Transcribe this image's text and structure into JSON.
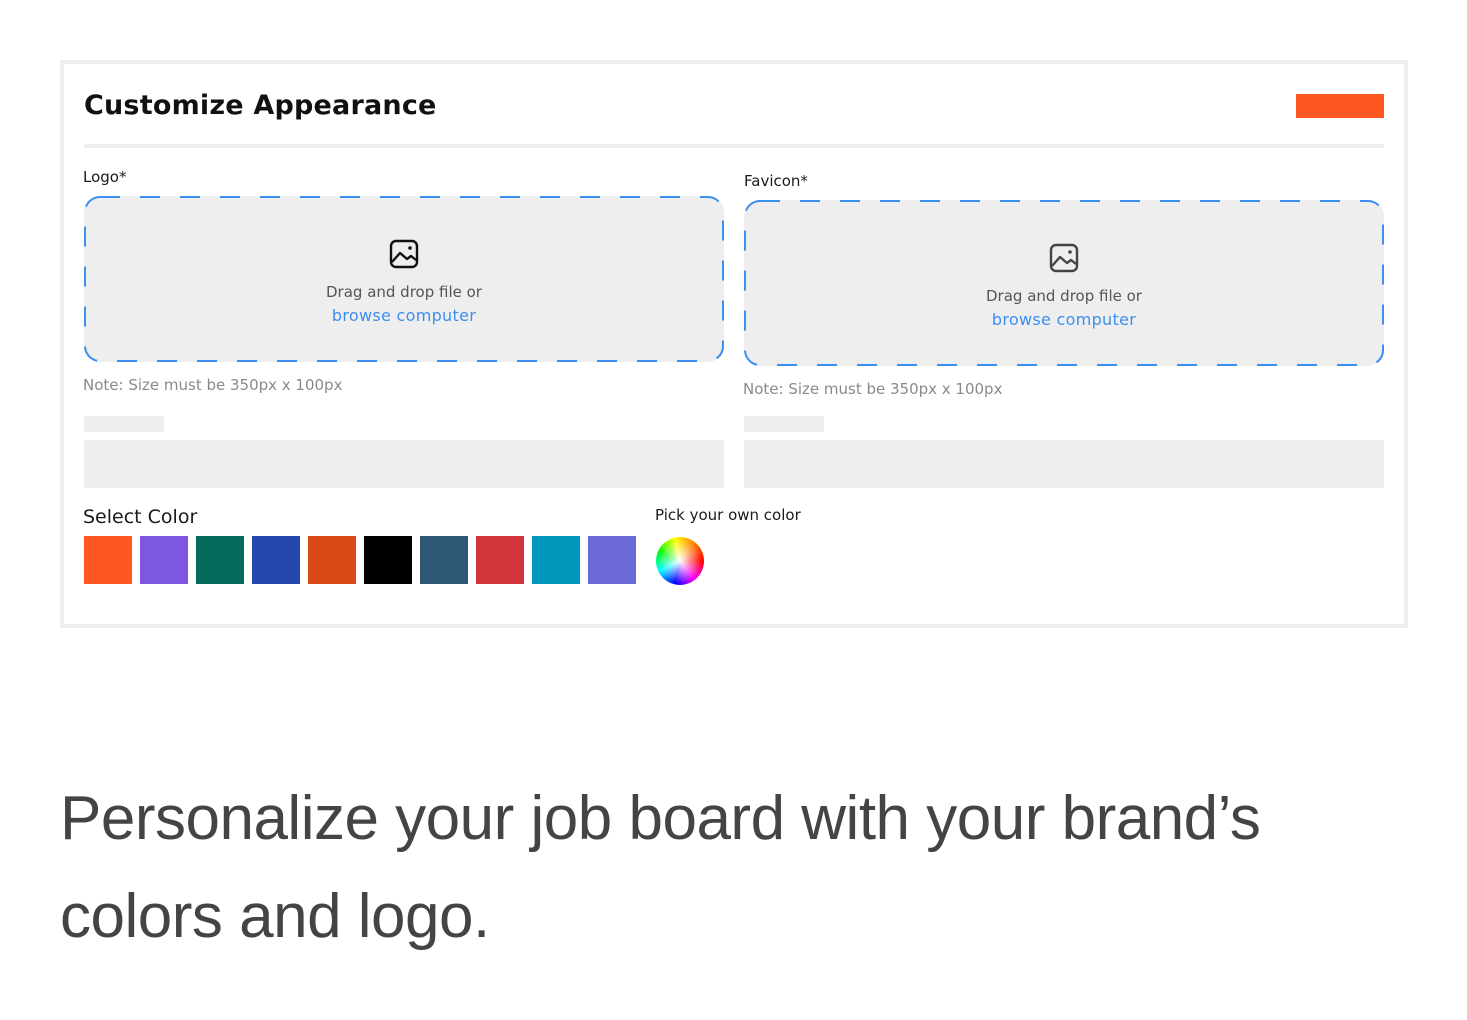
{
  "card": {
    "title": "Customize Appearance",
    "save_button_color": "#ff5722"
  },
  "logo": {
    "label": "Logo*",
    "dropzone": {
      "icon": "image-icon",
      "text": "Drag and drop file or",
      "link": "browse computer"
    },
    "note": "Note: Size must be 350px x 100px"
  },
  "favicon": {
    "label": "Favicon*",
    "dropzone": {
      "icon": "image-icon",
      "text": "Drag and drop file or",
      "link": "browse computer"
    },
    "note": "Note: Size must be 350px x 100px"
  },
  "colors": {
    "label": "Select Color",
    "swatches": [
      "#ff5722",
      "#7e57e0",
      "#066b5c",
      "#2447ab",
      "#d84b16",
      "#000000",
      "#2d5773",
      "#d3333a",
      "#0099bb",
      "#6c6ad6"
    ],
    "pick_label": "Pick your own color",
    "picker_icon": "color-wheel-icon"
  },
  "accent_color": "#3b8ff0",
  "tagline": "Personalize your job board with your brand’s colors and logo."
}
